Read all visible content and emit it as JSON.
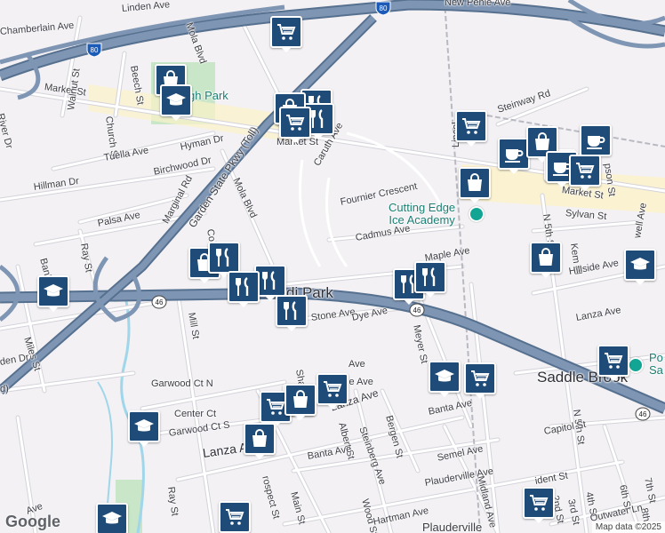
{
  "colors": {
    "background": "#f3f1f4",
    "highway": "#7e95b3",
    "highway_casing": "#56708f",
    "street": "#ffffff",
    "street_casing": "#d4d3da",
    "rail": "#b9b9c2",
    "park": "#c9e6c9",
    "water": "#9fd6ea",
    "commercial": "#fbf2c8",
    "pin": "#1e4b77",
    "poi": "#12a594"
  },
  "labels": {
    "linden_ave": "Linden Ave",
    "chamberlain_ave": "Chamberlain Ave",
    "new_pehle_ave": "New Pehle Ave",
    "mola_blvd_n": "Mola Blvd",
    "beech_st": "Beech St",
    "market_st_w": "Market St",
    "market_st_e": "Market St",
    "market_st_mid": "Market St",
    "rochelle_park": "gh Park",
    "river_dr": "River Dr",
    "walnut_st": "Walnut St",
    "church_st": "Church St",
    "tuella_ave": "Tuella Ave",
    "hyman_dr": "Hyman Dr",
    "birchwood_dr": "Birchwood Dr",
    "hillman_dr": "Hillman Dr",
    "marginal_rd": "Marginal Rd",
    "gsp": "Garden State Pkwy (Toll)",
    "mola_blvd_s": "Mola Blvd",
    "caruth_ave": "Caruth Ave",
    "fournier_crescent": "Fournier Crescent",
    "palsa_ave": "Palsa Ave",
    "ray_st_n": "Ray St",
    "ray_st_s": "Ray St",
    "cadmus_ave": "Cadmus Ave",
    "bank_st": "Bank",
    "steinway_rd": "Steinway Rd",
    "lincoln": "Lincol",
    "maple_ave": "Maple Ave",
    "sylvan_st": "Sylvan St",
    "n5th_st_n": "N 5th St",
    "kem_pl": "Kem Pl",
    "hillside_ave": "Hillside Ave",
    "coles": "Col",
    "park_ave": "pson St",
    "howell_ave": "well Ave",
    "lodi_park": "di Park",
    "mill_st": "Mill St",
    "miles_st": "Miles St",
    "linden_dr": "den Dr",
    "stone_ave": "Stone Ave",
    "dye_ave": "Dye Ave",
    "meyer_st": "Meyer St",
    "lanza_ave_e": "Lanza Ave",
    "saddle_brook": "Saddle Brook",
    "garwood_ct_n": "Garwood Ct N",
    "center_ct": "Center Ct",
    "garwood_ct_s": "Garwood Ct S",
    "lanza_ave_w": "Lanza A",
    "sha_st": "Sha",
    "ave_1": "Ave",
    "ave_2": "ine Ave",
    "lanza_ave_mid": "Lanza Ave",
    "albert_st": "Albert St",
    "steinberg_ave": "Steinberg Ave",
    "bergen_st": "Bergen St",
    "banta_ave_e": "Banta Ave",
    "banta_ave_w": "Banta Ave",
    "prospect_st": "rospect St",
    "main_st": "Main St",
    "ray_st_lower": "Ray St",
    "semel_ave": "Semel Ave",
    "midland_ave": "Midland Ave",
    "n5th_st_s": "N 5th St",
    "capitol_st": "Capitol St",
    "plauderville_ave": "Plauderville Ave",
    "wood_st": "Wood St",
    "hartman_ave": "Hartman Ave",
    "president_st": "ident St",
    "ave_left": "Ave",
    "st_2nd": "2nd St",
    "st_3rd": "3rd St",
    "st_4th": "4th St",
    "st_6th": "6th St",
    "st_7th": "7th St",
    "st_8th": "8th",
    "outwater_ln": "Outwater Ln",
    "ave_left_mid": "Ave",
    "plauderville": "Plauderville",
    "ice_academy": "Cutting Edge\nIce Academy",
    "po": "Po\nSa",
    "d_left": "d)"
  },
  "shields": {
    "i80_top": "80",
    "i80_left": "80",
    "rt46_w": "46",
    "rt46_mid": "46",
    "rt46_e": "46"
  },
  "pins": [
    {
      "icon": "cart-icon"
    },
    {
      "icon": "shopping-bag-icon"
    },
    {
      "icon": "school-icon"
    },
    {
      "icon": "restaurant-icon"
    },
    {
      "icon": "restaurant-icon"
    },
    {
      "icon": "restaurant-icon"
    },
    {
      "icon": "shopping-bag-icon"
    },
    {
      "icon": "cart-icon"
    },
    {
      "icon": "shopping-bag-icon"
    },
    {
      "icon": "coffee-icon"
    },
    {
      "icon": "coffee-icon"
    },
    {
      "icon": "coffee-icon"
    },
    {
      "icon": "cart-icon"
    },
    {
      "icon": "shopping-bag-icon"
    },
    {
      "icon": "coffee-icon"
    },
    {
      "icon": "shopping-bag-icon"
    },
    {
      "icon": "school-icon"
    },
    {
      "icon": "shopping-bag-icon"
    },
    {
      "icon": "restaurant-icon"
    },
    {
      "icon": "restaurant-icon"
    },
    {
      "icon": "restaurant-icon"
    },
    {
      "icon": "school-icon"
    },
    {
      "icon": "restaurant-icon"
    },
    {
      "icon": "restaurant-icon"
    },
    {
      "icon": "restaurant-icon"
    },
    {
      "icon": "school-icon"
    },
    {
      "icon": "cart-icon"
    },
    {
      "icon": "cart-icon"
    },
    {
      "icon": "cart-icon"
    },
    {
      "icon": "shopping-bag-icon"
    },
    {
      "icon": "cart-icon"
    },
    {
      "icon": "shopping-bag-icon"
    },
    {
      "icon": "school-icon"
    },
    {
      "icon": "school-icon"
    },
    {
      "icon": "cart-icon"
    },
    {
      "icon": "cart-icon"
    },
    {
      "icon": "cart-icon"
    },
    {
      "icon": "cart-icon"
    }
  ],
  "logo": "Google",
  "attribution": "Map data ©2025"
}
